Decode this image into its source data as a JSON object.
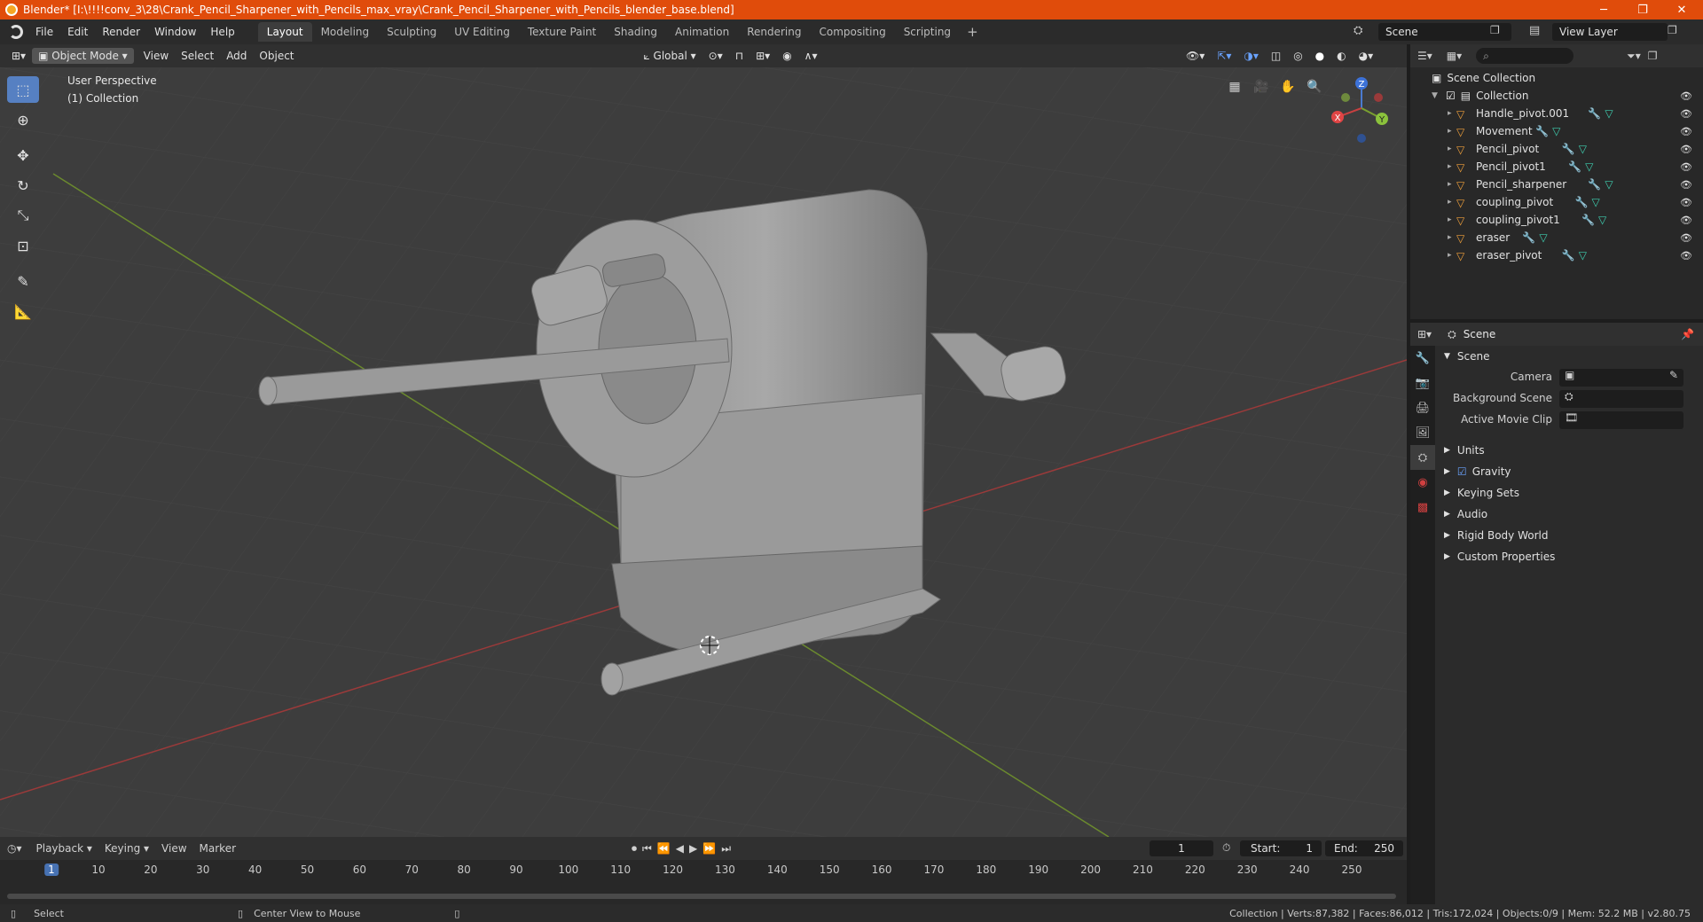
{
  "window": {
    "title": "Blender* [I:\\!!!!conv_3\\28\\Crank_Pencil_Sharpener_with_Pencils_max_vray\\Crank_Pencil_Sharpener_with_Pencils_blender_base.blend]",
    "minimize": "─",
    "maximize": "❐",
    "close": "✕"
  },
  "menubar": {
    "items": [
      "File",
      "Edit",
      "Render",
      "Window",
      "Help"
    ]
  },
  "workspaces": {
    "tabs": [
      "Layout",
      "Modeling",
      "Sculpting",
      "UV Editing",
      "Texture Paint",
      "Shading",
      "Animation",
      "Rendering",
      "Compositing",
      "Scripting"
    ],
    "active": "Layout",
    "add": "+"
  },
  "scene_selector": {
    "value": "Scene"
  },
  "view_layer_selector": {
    "value": "View Layer"
  },
  "viewport_header": {
    "mode": "Object Mode",
    "menus": [
      "View",
      "Select",
      "Add",
      "Object"
    ],
    "orientation": "Global"
  },
  "viewport": {
    "perspective_label": "User Perspective",
    "collection_label": "(1) Collection",
    "gizmo": {
      "z": "Z",
      "y": "Y",
      "x": "X"
    }
  },
  "outliner": {
    "root": "Scene Collection",
    "collection": "Collection",
    "objects": [
      "Handle_pivot.001",
      "Movement",
      "Pencil_pivot",
      "Pencil_pivot1",
      "Pencil_sharpener",
      "coupling_pivot",
      "coupling_pivot1",
      "eraser",
      "eraser_pivot"
    ]
  },
  "properties": {
    "header": "Scene",
    "section": "Scene",
    "fields": {
      "camera_label": "Camera",
      "background_label": "Background Scene",
      "movie_clip_label": "Active Movie Clip"
    },
    "subsections": [
      "Units",
      "Gravity",
      "Keying Sets",
      "Audio",
      "Rigid Body World",
      "Custom Properties"
    ],
    "gravity_checked": true
  },
  "timeline": {
    "menus": [
      "Playback",
      "Keying",
      "View",
      "Marker"
    ],
    "current_frame": "1",
    "start_label": "Start:",
    "start_value": "1",
    "end_label": "End:",
    "end_value": "250",
    "ticks": [
      "1",
      "10",
      "20",
      "30",
      "40",
      "50",
      "60",
      "70",
      "80",
      "90",
      "100",
      "110",
      "120",
      "130",
      "140",
      "150",
      "160",
      "170",
      "180",
      "190",
      "200",
      "210",
      "220",
      "230",
      "240",
      "250"
    ]
  },
  "statusbar": {
    "left_action": "Select",
    "middle_action": "Center View to Mouse",
    "stats": "Collection | Verts:87,382 | Faces:86,012 | Tris:172,024 | Objects:0/9 | Mem: 52.2 MB | v2.80.75"
  },
  "colors": {
    "titlebar": "#e04c0b",
    "accent": "#5680c2",
    "object_icon": "#f0a03b"
  }
}
